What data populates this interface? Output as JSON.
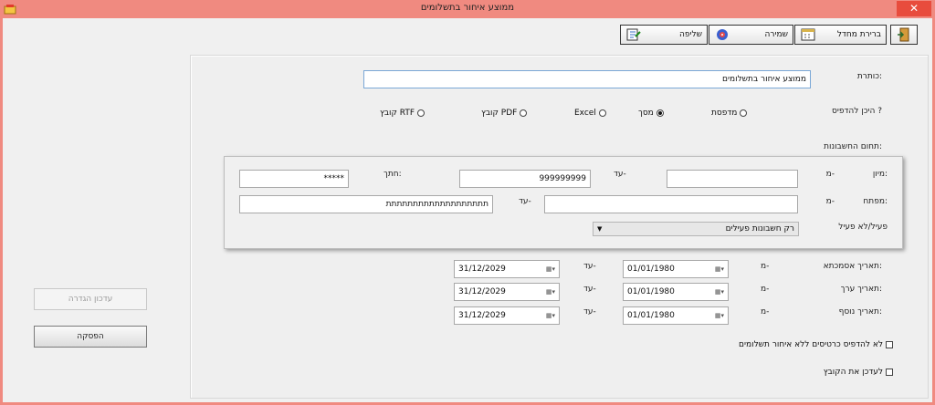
{
  "window": {
    "title": "ממוצע איחור בתשלומים",
    "close_glyph": "✕"
  },
  "toolbar": {
    "exit_icon": "exit-door-icon",
    "define_default_label": "ברירת מחדל",
    "save_label": "שמירה",
    "load_label": "שליפה"
  },
  "form": {
    "title_label": "כותרת:",
    "title_value": "ממוצע איחור בתשלומים",
    "print_to_label": "היכן להדפיס ?",
    "print_options": [
      "מדפסת",
      "מסך",
      "Excel",
      "קובץ PDF",
      "קובץ RTF"
    ],
    "print_selected": "מסך",
    "accounts_range_label": "תחום החשבונות:",
    "sort_label": "מיון:",
    "from": "מ-",
    "to": "עד-",
    "sort_to_value": "999999999",
    "section_label": "חתך:",
    "section_value": "*****",
    "key_label": "מפתח:",
    "key_to_value": "תתתתתתתתתתתתתתתתתתת",
    "active_label": "פעיל/לא פעיל",
    "active_value": "רק חשבונות פעילים",
    "dates": [
      {
        "label": "תאריך אסמכתא:",
        "from": "01/01/1980",
        "to": "31/12/2029"
      },
      {
        "label": "תאריך ערך:",
        "from": "01/01/1980",
        "to": "31/12/2029"
      },
      {
        "label": "תאריך נוסף:",
        "from": "01/01/1980",
        "to": "31/12/2029"
      }
    ],
    "chk_no_delay_label": "לא להדפיס כרטיסים ללא איחור תשלומים",
    "chk_update_file_label": "לעדכן את הקובץ"
  },
  "side": {
    "update_report_label": "עדכון הגדרה",
    "stop_label": "הפסקה"
  }
}
